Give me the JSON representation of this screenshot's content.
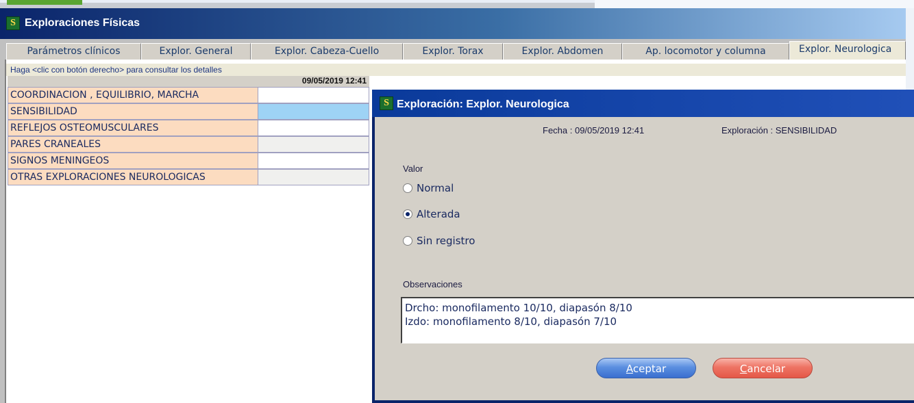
{
  "window": {
    "title": "Exploraciones Físicas",
    "icon_letter": "S"
  },
  "tabs": [
    {
      "label": "Parámetros clínicos"
    },
    {
      "label": "Explor. General"
    },
    {
      "label": "Explor. Cabeza-Cuello"
    },
    {
      "label": "Explor. Torax"
    },
    {
      "label": "Explor. Abdomen"
    },
    {
      "label": "Ap. locomotor y columna"
    },
    {
      "label": "Explor. Neurologica"
    }
  ],
  "active_tab": "Explor. Neurologica",
  "hint": "Haga <clic con botón derecho> para consultar los detalles",
  "grid": {
    "date_header": "09/05/2019 12:41",
    "rows": [
      {
        "label": "COORDINACION , EQUILIBRIO, MARCHA"
      },
      {
        "label": "SENSIBILIDAD"
      },
      {
        "label": "REFLEJOS OSTEOMUSCULARES"
      },
      {
        "label": "PARES CRANEALES"
      },
      {
        "label": "SIGNOS MENINGEOS"
      },
      {
        "label": "OTRAS EXPLORACIONES NEUROLOGICAS"
      }
    ]
  },
  "dialog": {
    "title": "Exploración: Explor. Neurologica",
    "fecha": "Fecha : 09/05/2019 12:41",
    "exploracion": "Exploración : SENSIBILIDAD",
    "valor_label": "Valor",
    "options": [
      {
        "label": "Normal",
        "selected": false
      },
      {
        "label": "Alterada",
        "selected": true
      },
      {
        "label": "Sin registro",
        "selected": false
      }
    ],
    "observaciones_label": "Observaciones",
    "observaciones_text": "Drcho: monofilamento 10/10, diapasón 8/10\nIzdo: monofilamento 8/10, diapasón 7/10",
    "accept_first": "A",
    "accept_rest": "ceptar",
    "cancel_first": "C",
    "cancel_rest": "ancelar"
  },
  "colors": {
    "title_dark": "#0a246a",
    "row_label_bg": "#fcdcc0",
    "selected_cell": "#9ed3f5",
    "accept_button": "#5b8fe0",
    "cancel_button": "#ee7464"
  }
}
